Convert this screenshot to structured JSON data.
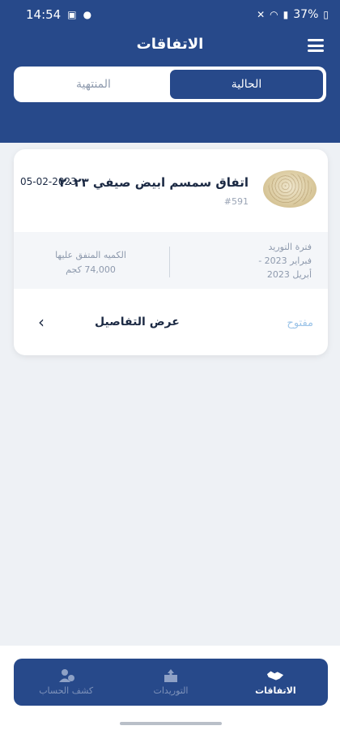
{
  "status_bar": {
    "time": "14:54",
    "battery": "37%"
  },
  "header": {
    "title": "الاتفاقات"
  },
  "tabs": [
    {
      "label": "الحالية",
      "active": true
    },
    {
      "label": "المنتهية",
      "active": false
    }
  ],
  "agreement": {
    "title": "اتفاق سمسم ابيض صيفي ٢٠٢٣",
    "date": "05-02-2023",
    "number": "#591",
    "supply_period_label": "فترة التوريد",
    "supply_period_from": "فبراير 2023  -",
    "supply_period_to": "أبريل 2023",
    "agreed_qty_label": "الكميه المتفق عليها",
    "agreed_qty_value": "74,000 كجم",
    "status": "مفتوح",
    "details_label": "عرض التفاصيل"
  },
  "bottom_nav": [
    {
      "label": "الاتفاقات",
      "icon": "handshake-icon",
      "active": true
    },
    {
      "label": "التوريدات",
      "icon": "upload-box-icon",
      "active": false
    },
    {
      "label": "كشف الحساب",
      "icon": "account-statement-icon",
      "active": false
    }
  ],
  "colors": {
    "primary": "#27498a",
    "background": "#eef1f5",
    "open_status": "#9cc4e8"
  }
}
